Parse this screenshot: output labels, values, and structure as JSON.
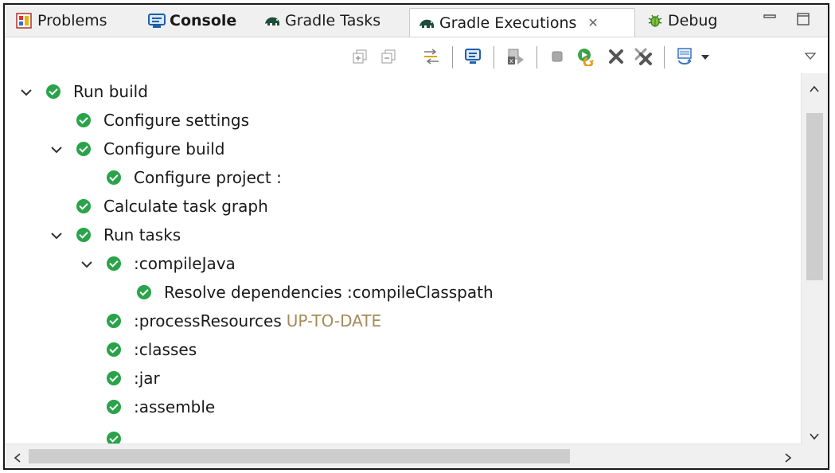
{
  "tabs": [
    {
      "label": "Problems",
      "icon": "problems-icon"
    },
    {
      "label": "Console",
      "icon": "console-icon",
      "bold": true
    },
    {
      "label": "Gradle Tasks",
      "icon": "gradle-elephant-icon"
    },
    {
      "label": "Gradle Executions",
      "icon": "gradle-elephant-icon",
      "active": true,
      "close": "✕"
    },
    {
      "label": "Debug",
      "icon": "debug-bug-icon"
    }
  ],
  "window_buttons": [
    "minimize-icon",
    "maximize-icon"
  ],
  "toolbar": [
    "expand-all-icon",
    "collapse-all-icon",
    "link-with-console-icon",
    "show-console-icon",
    "remove-execution-icon",
    "stop-icon",
    "rerun-build-icon",
    "remove-icon",
    "remove-all-icon",
    "select-page-icon",
    "view-menu-icon"
  ],
  "tree": [
    {
      "label": "Run build",
      "status": "",
      "level": 0,
      "expanded": true
    },
    {
      "label": "Configure settings",
      "status": "",
      "level": 1,
      "expanded": null
    },
    {
      "label": "Configure build",
      "status": "",
      "level": 1,
      "expanded": true
    },
    {
      "label": "Configure project :",
      "status": "",
      "level": 2,
      "expanded": null
    },
    {
      "label": "Calculate task graph",
      "status": "",
      "level": 1,
      "expanded": null
    },
    {
      "label": "Run tasks",
      "status": "",
      "level": 1,
      "expanded": true
    },
    {
      "label": ":compileJava",
      "status": "",
      "level": 2,
      "expanded": true
    },
    {
      "label": "Resolve dependencies :compileClasspath",
      "status": "",
      "level": 3,
      "expanded": null
    },
    {
      "label": ":processResources",
      "status": "UP-TO-DATE",
      "level": 2,
      "expanded": null
    },
    {
      "label": ":classes",
      "status": "",
      "level": 2,
      "expanded": null
    },
    {
      "label": ":jar",
      "status": "",
      "level": 2,
      "expanded": null
    },
    {
      "label": ":assemble",
      "status": "",
      "level": 2,
      "expanded": null
    }
  ],
  "scroll": {
    "vertical_fraction": 0.0,
    "horizontal_fraction": 0.0
  },
  "colors": {
    "success": "#2aa34a",
    "status_text": "#a38c5a",
    "accent": "#0b5db0"
  }
}
